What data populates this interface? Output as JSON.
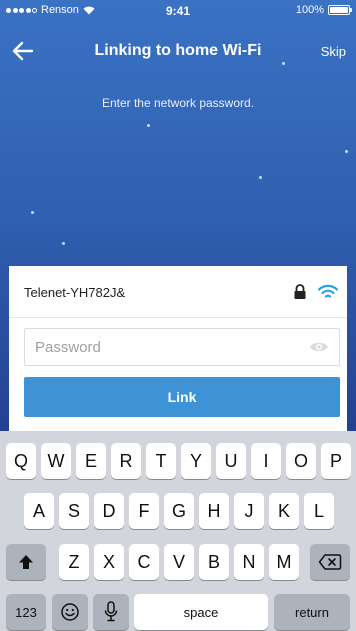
{
  "status_bar": {
    "carrier": "Renson",
    "time": "9:41",
    "battery": "100%",
    "battery_level": 1.0
  },
  "header": {
    "title": "Linking to home Wi-Fi",
    "skip_label": "Skip",
    "back_icon": "arrow-left-icon"
  },
  "instruction": "Enter the network password.",
  "network": {
    "ssid": "Telenet-YH782J&",
    "lock_icon": "lock-icon",
    "wifi_icon": "wifi-icon"
  },
  "password": {
    "value": "",
    "placeholder": "Password",
    "eye_icon": "eye-icon"
  },
  "link_button_label": "Link",
  "colors": {
    "accent": "#3d93d6",
    "background_top": "#3a72c4",
    "background_bottom": "#1b2f6e",
    "wifi": "#2aa3e0"
  },
  "keyboard": {
    "row1": [
      "Q",
      "W",
      "E",
      "R",
      "T",
      "Y",
      "U",
      "I",
      "O",
      "P"
    ],
    "row2": [
      "A",
      "S",
      "D",
      "F",
      "G",
      "H",
      "J",
      "K",
      "L"
    ],
    "row3": [
      "Z",
      "X",
      "C",
      "V",
      "B",
      "N",
      "M"
    ],
    "numbers_label": "123",
    "space_label": "space",
    "return_label": "return",
    "shift_icon": "shift-icon",
    "backspace_icon": "backspace-icon",
    "emoji_icon": "emoji-icon",
    "mic_icon": "microphone-icon"
  }
}
